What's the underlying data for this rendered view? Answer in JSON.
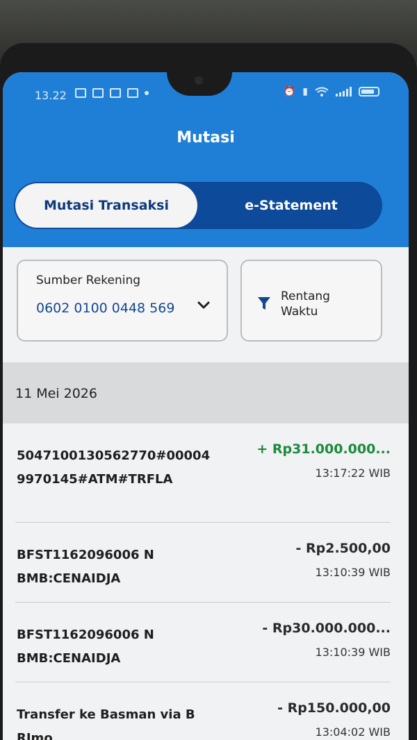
{
  "status_bar": {
    "time": "13.22"
  },
  "header": {
    "title": "Mutasi"
  },
  "tabs": [
    {
      "label": "Mutasi Transaksi",
      "active": true
    },
    {
      "label": "e-Statement",
      "active": false
    }
  ],
  "filters": {
    "account_label": "Sumber Rekening",
    "account_number": "0602 0100 0448 569",
    "range_label": "Rentang Waktu"
  },
  "date_group": "11 Mei 2026",
  "transactions": [
    {
      "description": "5047100130562770#000049970145#ATM#TRFLA",
      "amount": "+ Rp31.000.000...",
      "time": "13:17:22 WIB",
      "type": "credit"
    },
    {
      "description": "BFST1162096006 NBMB:CENAIDJA",
      "amount": "- Rp2.500,00",
      "time": "13:10:39 WIB",
      "type": "debit"
    },
    {
      "description": "BFST1162096006 NBMB:CENAIDJA",
      "amount": "- Rp30.000.000...",
      "time": "13:10:39 WIB",
      "type": "debit"
    },
    {
      "description": "Transfer ke Basman via BRImo",
      "amount": "- Rp150.000,00",
      "time": "13:04:02 WIB",
      "type": "debit"
    }
  ],
  "colors": {
    "header_blue": "#1f7fd6",
    "tab_dark": "#0d4a99",
    "credit_green": "#1b8a3a"
  },
  "icons": [
    "chevron-down-icon",
    "filter-icon",
    "battery-icon",
    "wifi-icon",
    "signal-icon",
    "alarm-icon"
  ]
}
